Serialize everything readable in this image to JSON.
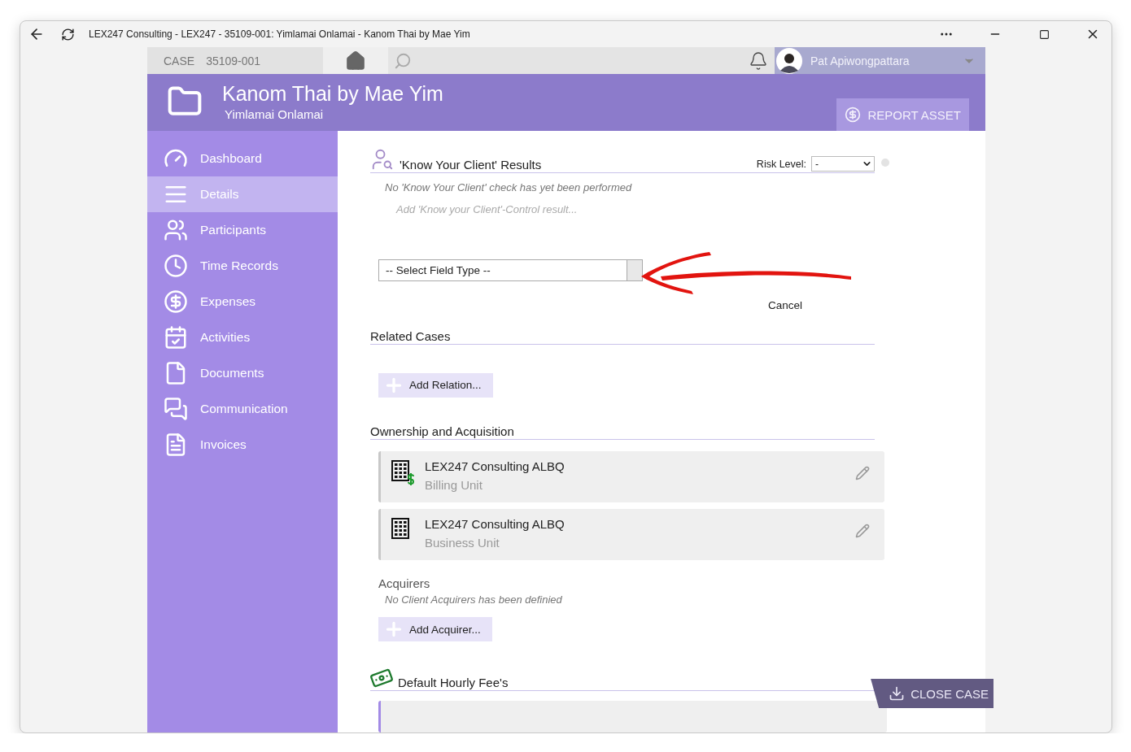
{
  "window": {
    "title": "LEX247 Consulting - LEX247 - 35109-001: Yimlamai Onlamai - Kanom Thai by Mae Yim"
  },
  "case_bar": {
    "label": "CASE",
    "number": "35109-001"
  },
  "user": {
    "name": "Pat Apiwongpattara"
  },
  "header": {
    "title": "Kanom Thai by Mae Yim",
    "subtitle": "Yimlamai Onlamai",
    "action": "REPORT ASSET"
  },
  "sidebar": {
    "items": [
      {
        "label": "Dashboard",
        "kind": "dashboard",
        "selected": false
      },
      {
        "label": "Details",
        "kind": "details",
        "selected": true
      },
      {
        "label": "Participants",
        "kind": "participants",
        "selected": false
      },
      {
        "label": "Time Records",
        "kind": "time",
        "selected": false
      },
      {
        "label": "Expenses",
        "kind": "expenses",
        "selected": false
      },
      {
        "label": "Activities",
        "kind": "activities",
        "selected": false
      },
      {
        "label": "Documents",
        "kind": "documents",
        "selected": false
      },
      {
        "label": "Communication",
        "kind": "communication",
        "selected": false
      },
      {
        "label": "Invoices",
        "kind": "invoices",
        "selected": false
      }
    ]
  },
  "kyc": {
    "title": "'Know Your Client' Results",
    "risk_label": "Risk Level:",
    "risk_value": "-",
    "empty": "No 'Know Your Client' check has yet been performed",
    "add_link": "Add 'Know your Client'-Control result...",
    "field_type": "-- Select Field Type --",
    "cancel": "Cancel"
  },
  "related_cases": {
    "title": "Related Cases",
    "add": "Add Relation..."
  },
  "ownership": {
    "title": "Ownership and Acquisition",
    "units": [
      {
        "name": "LEX247 Consulting ALBQ",
        "role": "Billing Unit",
        "kind": "billing"
      },
      {
        "name": "LEX247 Consulting ALBQ",
        "role": "Business Unit",
        "kind": "business"
      }
    ],
    "acquirers_title": "Acquirers",
    "acquirers_empty": "No Client Acquirers has been definied",
    "add": "Add Acquirer..."
  },
  "fees": {
    "title": "Default Hourly Fee's"
  },
  "close_case": "CLOSE CASE"
}
